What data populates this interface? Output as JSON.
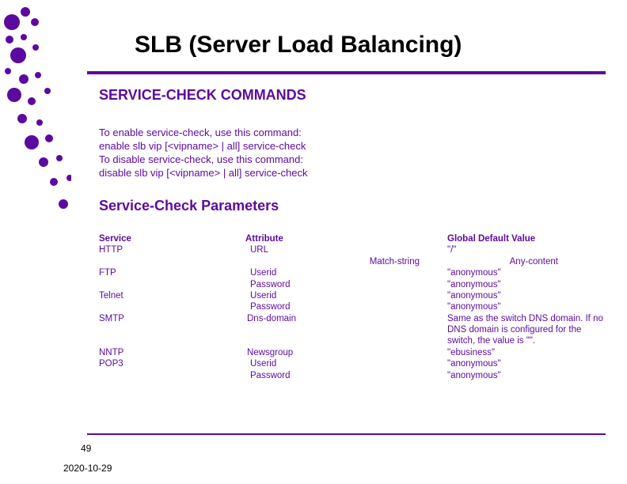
{
  "title": "SLB (Server Load Balancing)",
  "section1": "SERVICE-CHECK COMMANDS",
  "cmd": {
    "l1": "To enable service-check, use this command:",
    "l2": "enable slb vip [<vipname> | all] service-check",
    "l3": "To disable service-check, use this command:",
    "l4": "disable slb vip [<vipname> | all] service-check"
  },
  "section2": "Service-Check Parameters",
  "headers": {
    "service": "Service",
    "attribute": "Attribute",
    "value": "Global Default Value"
  },
  "svc": {
    "http": "HTTP",
    "ftp": "FTP",
    "telnet": "Telnet",
    "smtp": "SMTP",
    "nntp": "NNTP",
    "pop3": "POP3"
  },
  "attr": {
    "url": "URL",
    "matchstring": "Match-string",
    "userid": "Userid",
    "password": "Password",
    "dnsdomain": "Dns-domain",
    "newsgroup": "Newsgroup"
  },
  "val": {
    "slash": "\"/\"",
    "anycontent": "Any-content",
    "anon": "\"anonymous\"",
    "smtp": "Same as the switch DNS domain. If no DNS domain is configured for the switch, the value is \"\".",
    "ebusiness": "\"ebusiness\""
  },
  "slide": "49",
  "date": "2020-10-29"
}
